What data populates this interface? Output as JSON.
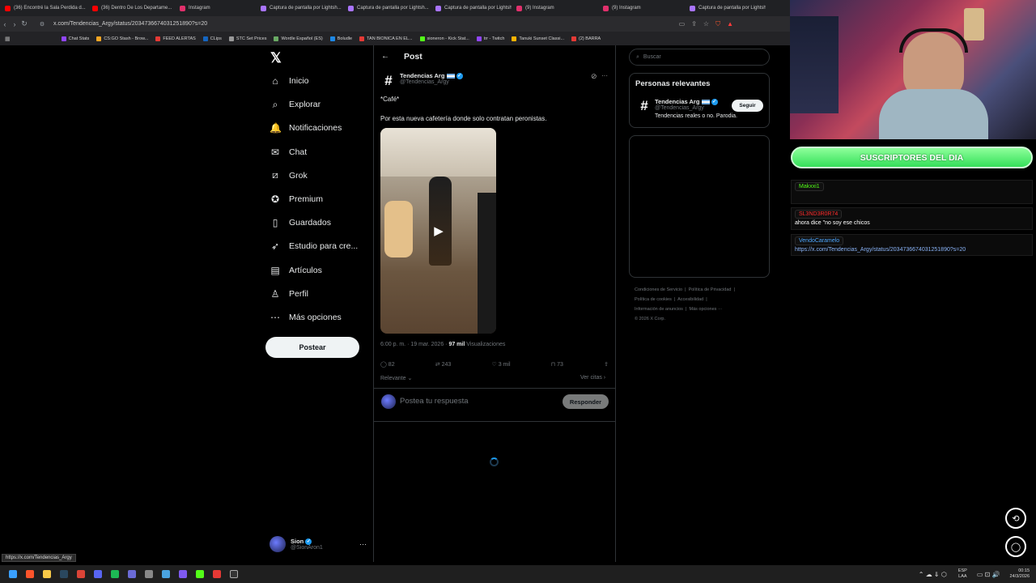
{
  "browser": {
    "tabs": [
      {
        "label": "(36) Encontré la Sala Perdida d...",
        "color": "#ff0000"
      },
      {
        "label": "(36) Dentro De Los Departame...",
        "color": "#ff0000"
      },
      {
        "label": "Instagram",
        "color": "#e1306c"
      },
      {
        "label": "Captura de pantalla por Lightsh...",
        "color": "#a974ff"
      },
      {
        "label": "Captura de pantalla por Lightsh...",
        "color": "#a974ff"
      },
      {
        "label": "Captura de pantalla por Lightsh...",
        "color": "#a974ff"
      },
      {
        "label": "(9) Instagram",
        "color": "#e1306c"
      },
      {
        "label": "(9) Instagram",
        "color": "#e1306c"
      },
      {
        "label": "Captura de pantalla por Lightsh...",
        "color": "#a974ff"
      }
    ],
    "url": "x.com/Tendencias_Argy/status/2034736674031251890?s=20",
    "bookmarks": [
      {
        "label": "Chat Stats",
        "color": "#9146ff"
      },
      {
        "label": "CS:GO Stash - Brow...",
        "color": "#f5a623"
      },
      {
        "label": "FEED ALERTAS",
        "color": "#e53935"
      },
      {
        "label": "CLips",
        "color": "#1565c0"
      },
      {
        "label": "STC Set Prices",
        "color": "#999"
      },
      {
        "label": "Wordle Español (ES)",
        "color": "#6aaa64"
      },
      {
        "label": "Boludle",
        "color": "#1e88e5"
      },
      {
        "label": "TAN BIONICA EN EL...",
        "color": "#e53935"
      },
      {
        "label": "sioneron - Kick Stat...",
        "color": "#53fc18"
      },
      {
        "label": "trr - Twitch",
        "color": "#9146ff"
      },
      {
        "label": "Tanuki Sunset Classi...",
        "color": "#ffb300"
      },
      {
        "label": "(2) BARRA",
        "color": "#e53935"
      }
    ],
    "status_url": "https://x.com/Tendencias_Argy"
  },
  "x": {
    "nav": [
      {
        "label": "Inicio",
        "icon": "home-icon",
        "glyph": "⌂"
      },
      {
        "label": "Explorar",
        "icon": "search-icon",
        "glyph": "⌕"
      },
      {
        "label": "Notificaciones",
        "icon": "bell-icon",
        "glyph": "🔔"
      },
      {
        "label": "Chat",
        "icon": "mail-icon",
        "glyph": "✉"
      },
      {
        "label": "Grok",
        "icon": "grok-icon",
        "glyph": "⧄"
      },
      {
        "label": "Premium",
        "icon": "premium-icon",
        "glyph": "✪"
      },
      {
        "label": "Guardados",
        "icon": "bookmark-icon",
        "glyph": "▯"
      },
      {
        "label": "Estudio para cre...",
        "icon": "rocket-icon",
        "glyph": "➶"
      },
      {
        "label": "Artículos",
        "icon": "article-icon",
        "glyph": "▤"
      },
      {
        "label": "Perfil",
        "icon": "person-icon",
        "glyph": "♙"
      },
      {
        "label": "Más opciones",
        "icon": "more-icon",
        "glyph": "⋯"
      }
    ],
    "post_button": "Postear",
    "account": {
      "name": "Sion",
      "handle": "@SionAron1"
    },
    "header_title": "Post",
    "post": {
      "author_name": "Tendencias Arg",
      "author_handle": "@Tendencias_Argy",
      "text_line1": "*Café*",
      "text_line2": "Por esta nueva cafetería donde solo contratan peronistas.",
      "time": "6:00 p. m. · 19 mar. 2026 · ",
      "views_count": "97 mil",
      "views_label": " Visualizaciones",
      "replies": "82",
      "reposts": "243",
      "likes": "3 mil",
      "bookmarks": "73",
      "sort_label": "Relevante",
      "quotes_label": "Ver citas",
      "reply_placeholder": "Postea tu respuesta",
      "reply_button": "Responder"
    },
    "search_placeholder": "Buscar",
    "relevant": {
      "title": "Personas relevantes",
      "name": "Tendencias Arg",
      "handle": "@Tendencias_Argy",
      "bio": "Tendencias reales o no. Parodia.",
      "follow": "Seguir"
    },
    "footer": {
      "line1": [
        "Condiciones de Servicio",
        "Política de Privacidad"
      ],
      "line2": [
        "Política de cookies",
        "Accesibilidad"
      ],
      "line3": [
        "Información de anuncios",
        "Más opciones ···"
      ],
      "line4": "© 2026 X Corp."
    }
  },
  "overlay": {
    "subs_title": "SUSCRIPTORES DEL DIA",
    "chat": [
      {
        "user": "Makxxi1",
        "color": "#53fc18",
        "msg": ""
      },
      {
        "user": "SL3ND3R0R74",
        "color": "#ff2d2d",
        "msg": "ahora dice \"no soy ese chicos"
      },
      {
        "user": "VendoCaramelo",
        "color": "#4ea8ff",
        "msg": "https://x.com/Tendencias_Argy/status/2034736674031251890?s=20"
      }
    ]
  },
  "taskbar": {
    "lang": "ESP",
    "lang2": "LAA",
    "time": "00:15",
    "date": "24/3/2026"
  }
}
